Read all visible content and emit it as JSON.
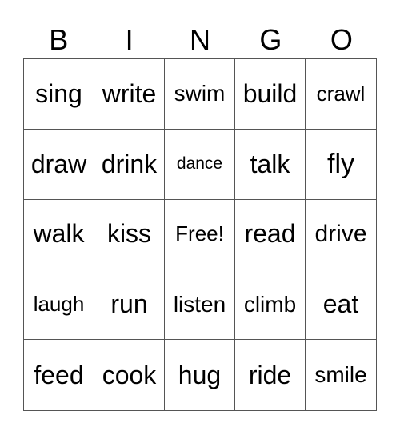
{
  "header": [
    "B",
    "I",
    "N",
    "G",
    "O"
  ],
  "cells": [
    "sing",
    "write",
    "swim",
    "build",
    "crawl",
    "draw",
    "drink",
    "dance",
    "talk",
    "fly",
    "walk",
    "kiss",
    "Free!",
    "read",
    "drive",
    "laugh",
    "run",
    "listen",
    "climb",
    "eat",
    "feed",
    "cook",
    "hug",
    "ride",
    "smile"
  ]
}
